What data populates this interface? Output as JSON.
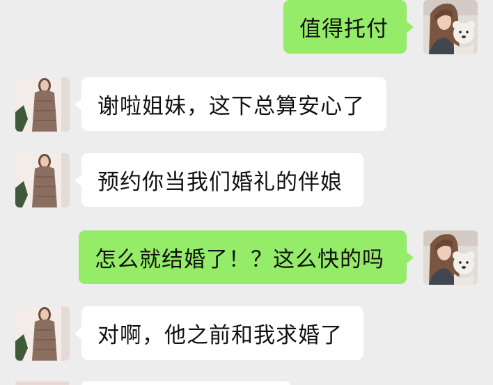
{
  "conversation": {
    "messages": [
      {
        "sender": "me",
        "text": "值得托付"
      },
      {
        "sender": "friend",
        "text": "谢啦姐妹，这下总算安心了"
      },
      {
        "sender": "friend",
        "text": "预约你当我们婚礼的伴娘"
      },
      {
        "sender": "me",
        "text": "怎么就结婚了！？这么快的吗"
      },
      {
        "sender": "friend",
        "text": "对啊，他之前和我求婚了"
      }
    ]
  },
  "colors": {
    "background": "#ededed",
    "my_bubble": "#95ec69",
    "friend_bubble": "#ffffff"
  },
  "avatars": {
    "me": "avatar-girl-with-teddy-bear",
    "friend": "avatar-woman-in-dress"
  }
}
